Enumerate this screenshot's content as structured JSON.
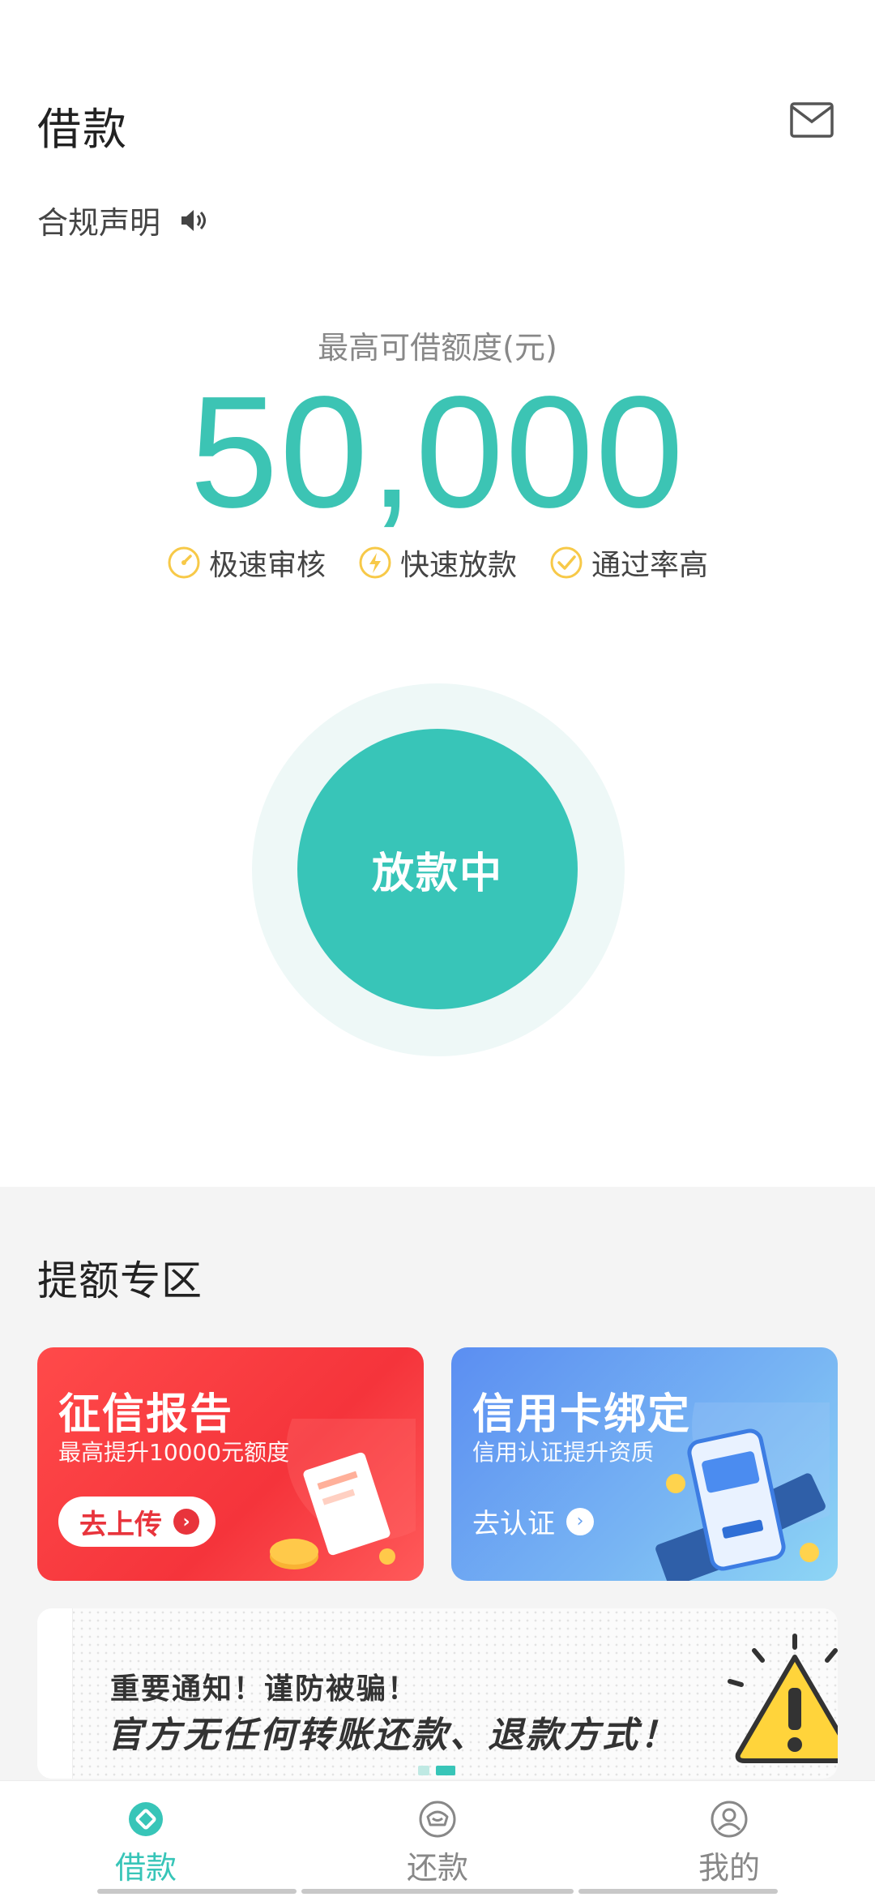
{
  "header": {
    "title": "借款",
    "notice_label": "合规声明",
    "mail_icon": "mail-icon",
    "speaker_icon": "speaker-icon"
  },
  "quota": {
    "label": "最高可借额度(元)",
    "amount": "50,000",
    "features": [
      {
        "label": "极速审核",
        "icon": "speed-check-icon"
      },
      {
        "label": "快速放款",
        "icon": "lightning-icon"
      },
      {
        "label": "通过率高",
        "icon": "check-circle-icon"
      }
    ]
  },
  "main_button": {
    "label": "放款中"
  },
  "boost_section": {
    "title": "提额专区",
    "cards": [
      {
        "title": "征信报告",
        "subtitle": "最高提升10000元额度",
        "action": "去上传",
        "color": "#f5343b"
      },
      {
        "title": "信用卡绑定",
        "subtitle": "信用认证提升资质",
        "action": "去认证",
        "color": "#6aa3f0"
      }
    ]
  },
  "banner": {
    "line1": "重要通知！谨防被骗！",
    "line2": "官方无任何转账还款、退款方式！",
    "icon": "warning-icon"
  },
  "tabbar": {
    "tabs": [
      {
        "label": "借款",
        "icon": "loan-icon",
        "active": true
      },
      {
        "label": "还款",
        "icon": "repay-icon",
        "active": false
      },
      {
        "label": "我的",
        "icon": "profile-icon",
        "active": false
      }
    ]
  },
  "colors": {
    "accent": "#38c5b8",
    "red": "#f5343b",
    "blue": "#6aa3f0"
  }
}
